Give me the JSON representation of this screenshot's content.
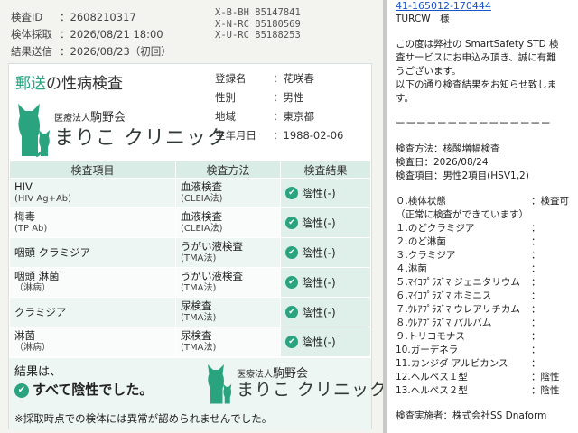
{
  "left": {
    "meta": [
      {
        "key": "検査ID",
        "value": "：2608210317"
      },
      {
        "key": "検体採取",
        "value": "：2026/08/21 18:00"
      },
      {
        "key": "結果送信",
        "value": "：2026/08/23（初回）"
      }
    ],
    "codes": [
      "X-B-BH 85147841",
      "X-N-RC 85180569",
      "X-U-RC 85188253"
    ],
    "title_highlight": "郵送",
    "title_rest": "の性病検査",
    "clinic_prefix": "医療法人",
    "clinic_name_small": "駒野会",
    "clinic_big": "まりこ クリニック",
    "info": [
      {
        "key": "登録名",
        "value": "：花咲春"
      },
      {
        "key": "性別",
        "value": "：男性"
      },
      {
        "key": "地域",
        "value": "：東京都"
      },
      {
        "key": "生年月日",
        "value": "：1988-02-06"
      }
    ],
    "table_headers": [
      "検査項目",
      "検査方法",
      "検査結果"
    ],
    "rows": [
      {
        "item": "HIV",
        "item_sub": "(HIV Ag+Ab)",
        "method": "血液検査",
        "method_sub": "(CLEIA法)",
        "result": "陰性(-)"
      },
      {
        "item": "梅毒",
        "item_sub": "(TP Ab)",
        "method": "血液検査",
        "method_sub": "(CLEIA法)",
        "result": "陰性(-)"
      },
      {
        "item": "咽頭 クラミジア",
        "item_sub": "",
        "method": "うがい液検査",
        "method_sub": "(TMA法)",
        "result": "陰性(-)"
      },
      {
        "item": "咽頭 淋菌",
        "item_sub": "（淋病）",
        "method": "うがい液検査",
        "method_sub": "(TMA法)",
        "result": "陰性(-)"
      },
      {
        "item": "クラミジア",
        "item_sub": "",
        "method": "尿検査",
        "method_sub": "(TMA法)",
        "result": "陰性(-)"
      },
      {
        "item": "淋菌",
        "item_sub": "（淋病）",
        "method": "尿検査",
        "method_sub": "(TMA法)",
        "result": "陰性(-)"
      }
    ],
    "summary_line1": "結果は、",
    "summary_line2": "すべて陰性でした。",
    "note": "※採取時点での検体には異常が認められませんでした。"
  },
  "right": {
    "link": "41-165012-170444",
    "addressee": "TURCW　様",
    "intro": [
      "この度は弊社の SmartSafety STD 検",
      "査サービスにお申込み頂き、誠に有難",
      "うございます。",
      "以下の通り検査結果をお知らせ致しま",
      "す。"
    ],
    "divider": "ーーーーーーーーーーーーーーー",
    "method_line": "検査方法：核酸増幅検査",
    "date_line": "検査日：2026/08/24",
    "items_line": "検査項目：男性2項目(HSV1,2)",
    "status_label": "０.検体状態",
    "status_value": "：検査可",
    "status_note": "（正常に検査ができています）",
    "results": [
      {
        "label": "１.のどクラミジア",
        "value": "："
      },
      {
        "label": "２.のど淋菌",
        "value": "："
      },
      {
        "label": "３.クラミジア",
        "value": "："
      },
      {
        "label": "４.淋菌",
        "value": "："
      },
      {
        "label": "５.ﾏｲｺﾌﾟﾗｽﾞﾏ ジェニタリウム",
        "value": "："
      },
      {
        "label": "６.ﾏｲｺﾌﾟﾗｽﾞﾏ ホミニス",
        "value": "："
      },
      {
        "label": "７.ｳﾚｱﾌﾟﾗｽﾞﾏ ウレアリチカム",
        "value": "："
      },
      {
        "label": "８.ｳﾚｱﾌﾟﾗｽﾞﾏ パルバム",
        "value": "："
      },
      {
        "label": "９.トリコモナス",
        "value": "："
      },
      {
        "label": "10.ガーデネラ",
        "value": "："
      },
      {
        "label": "11.カンジダ アルビカンス",
        "value": "："
      },
      {
        "label": "12.ヘルペス１型",
        "value": "：陰性"
      },
      {
        "label": "13.ヘルペス２型",
        "value": "：陰性"
      }
    ],
    "footer": "検査実施者：株式会社SS Dnaform"
  }
}
